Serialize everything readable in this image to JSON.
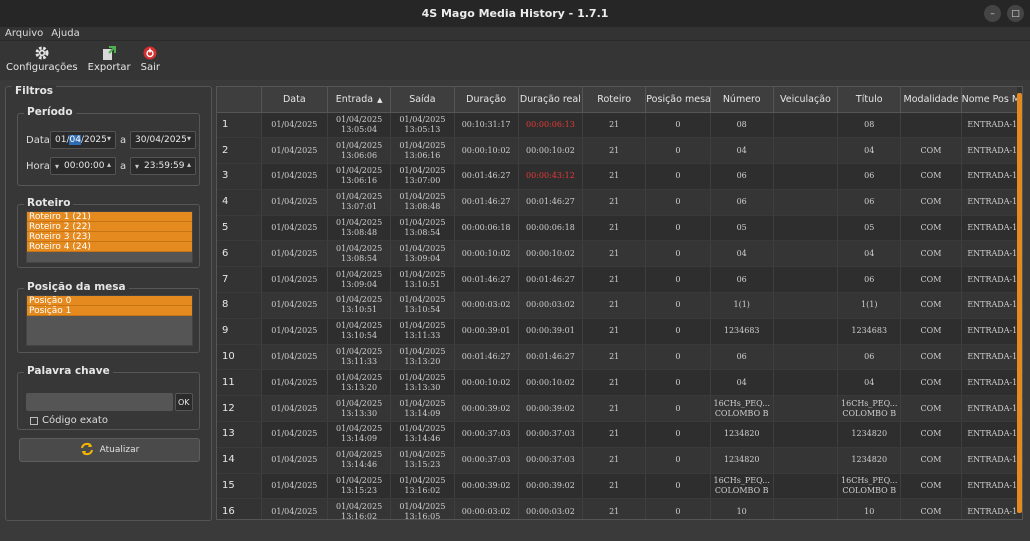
{
  "window": {
    "title": "4S Mago Media History - 1.7.1"
  },
  "menu": [
    "Arquivo",
    "Ajuda"
  ],
  "toolbar": {
    "config": "Configurações",
    "export": "Exportar",
    "exit": "Sair"
  },
  "filters": {
    "title": "Filtros",
    "period": {
      "title": "Período",
      "date_label": "Data",
      "date_from_pre": "01/",
      "date_from_sel": "04",
      "date_from_post": "/2025",
      "sep": "a",
      "date_to": "30/04/2025",
      "time_label": "Hora",
      "time_from": "00:00:00",
      "time_to": "23:59:59"
    },
    "roteiro": {
      "title": "Roteiro",
      "items": [
        "Roteiro 1 (21)",
        "Roteiro 2 (22)",
        "Roteiro 3 (23)",
        "Roteiro 4 (24)"
      ]
    },
    "posicao": {
      "title": "Posição da mesa",
      "items": [
        "Posição 0",
        "Posição 1"
      ]
    },
    "keyword": {
      "title": "Palavra chave",
      "value": "",
      "ok": "OK",
      "exact": "Código exato"
    },
    "refresh": "Atualizar"
  },
  "colors": {
    "accent": "#e58a1f",
    "red": "#e53935"
  },
  "table": {
    "headers": [
      "Data",
      "Entrada",
      "Saída",
      "Duração",
      "Duração real",
      "Roteiro",
      "Posição mesa",
      "Número",
      "Veiculação",
      "Título",
      "Modalidade",
      "Nome Pos Mes"
    ],
    "sort_indicator": "▲",
    "rows": [
      {
        "n": "1",
        "data": "01/04/2025",
        "entrada": [
          "01/04/2025",
          "13:05:04"
        ],
        "saida": [
          "01/04/2025",
          "13:05:13"
        ],
        "duracao": "00:10:31:17",
        "real": "00:00:06:13",
        "real_red": true,
        "roteiro": "21",
        "pos": "0",
        "numero": [
          "08"
        ],
        "veic": "",
        "titulo": [
          "08"
        ],
        "mod": "",
        "nome": "ENTRADA-1"
      },
      {
        "n": "2",
        "data": "01/04/2025",
        "entrada": [
          "01/04/2025",
          "13:06:06"
        ],
        "saida": [
          "01/04/2025",
          "13:06:16"
        ],
        "duracao": "00:00:10:02",
        "real": "00:00:10:02",
        "real_red": false,
        "roteiro": "21",
        "pos": "0",
        "numero": [
          "04"
        ],
        "veic": "",
        "titulo": [
          "04"
        ],
        "mod": "COM",
        "nome": "ENTRADA-1"
      },
      {
        "n": "3",
        "data": "01/04/2025",
        "entrada": [
          "01/04/2025",
          "13:06:16"
        ],
        "saida": [
          "01/04/2025",
          "13:07:00"
        ],
        "duracao": "00:01:46:27",
        "real": "00:00:43:12",
        "real_red": true,
        "roteiro": "21",
        "pos": "0",
        "numero": [
          "06"
        ],
        "veic": "",
        "titulo": [
          "06"
        ],
        "mod": "COM",
        "nome": "ENTRADA-1"
      },
      {
        "n": "4",
        "data": "01/04/2025",
        "entrada": [
          "01/04/2025",
          "13:07:01"
        ],
        "saida": [
          "01/04/2025",
          "13:08:48"
        ],
        "duracao": "00:01:46:27",
        "real": "00:01:46:27",
        "real_red": false,
        "roteiro": "21",
        "pos": "0",
        "numero": [
          "06"
        ],
        "veic": "",
        "titulo": [
          "06"
        ],
        "mod": "COM",
        "nome": "ENTRADA-1"
      },
      {
        "n": "5",
        "data": "01/04/2025",
        "entrada": [
          "01/04/2025",
          "13:08:48"
        ],
        "saida": [
          "01/04/2025",
          "13:08:54"
        ],
        "duracao": "00:00:06:18",
        "real": "00:00:06:18",
        "real_red": false,
        "roteiro": "21",
        "pos": "0",
        "numero": [
          "05"
        ],
        "veic": "",
        "titulo": [
          "05"
        ],
        "mod": "COM",
        "nome": "ENTRADA-1"
      },
      {
        "n": "6",
        "data": "01/04/2025",
        "entrada": [
          "01/04/2025",
          "13:08:54"
        ],
        "saida": [
          "01/04/2025",
          "13:09:04"
        ],
        "duracao": "00:00:10:02",
        "real": "00:00:10:02",
        "real_red": false,
        "roteiro": "21",
        "pos": "0",
        "numero": [
          "04"
        ],
        "veic": "",
        "titulo": [
          "04"
        ],
        "mod": "COM",
        "nome": "ENTRADA-1"
      },
      {
        "n": "7",
        "data": "01/04/2025",
        "entrada": [
          "01/04/2025",
          "13:09:04"
        ],
        "saida": [
          "01/04/2025",
          "13:10:51"
        ],
        "duracao": "00:01:46:27",
        "real": "00:01:46:27",
        "real_red": false,
        "roteiro": "21",
        "pos": "0",
        "numero": [
          "06"
        ],
        "veic": "",
        "titulo": [
          "06"
        ],
        "mod": "COM",
        "nome": "ENTRADA-1"
      },
      {
        "n": "8",
        "data": "01/04/2025",
        "entrada": [
          "01/04/2025",
          "13:10:51"
        ],
        "saida": [
          "01/04/2025",
          "13:10:54"
        ],
        "duracao": "00:00:03:02",
        "real": "00:00:03:02",
        "real_red": false,
        "roteiro": "21",
        "pos": "0",
        "numero": [
          "1(1)"
        ],
        "veic": "",
        "titulo": [
          "1(1)"
        ],
        "mod": "COM",
        "nome": "ENTRADA-1"
      },
      {
        "n": "9",
        "data": "01/04/2025",
        "entrada": [
          "01/04/2025",
          "13:10:54"
        ],
        "saida": [
          "01/04/2025",
          "13:11:33"
        ],
        "duracao": "00:00:39:01",
        "real": "00:00:39:01",
        "real_red": false,
        "roteiro": "21",
        "pos": "0",
        "numero": [
          "1234683"
        ],
        "veic": "",
        "titulo": [
          "1234683"
        ],
        "mod": "COM",
        "nome": "ENTRADA-1"
      },
      {
        "n": "10",
        "data": "01/04/2025",
        "entrada": [
          "01/04/2025",
          "13:11:33"
        ],
        "saida": [
          "01/04/2025",
          "13:13:20"
        ],
        "duracao": "00:01:46:27",
        "real": "00:01:46:27",
        "real_red": false,
        "roteiro": "21",
        "pos": "0",
        "numero": [
          "06"
        ],
        "veic": "",
        "titulo": [
          "06"
        ],
        "mod": "COM",
        "nome": "ENTRADA-1"
      },
      {
        "n": "11",
        "data": "01/04/2025",
        "entrada": [
          "01/04/2025",
          "13:13:20"
        ],
        "saida": [
          "01/04/2025",
          "13:13:30"
        ],
        "duracao": "00:00:10:02",
        "real": "00:00:10:02",
        "real_red": false,
        "roteiro": "21",
        "pos": "0",
        "numero": [
          "04"
        ],
        "veic": "",
        "titulo": [
          "04"
        ],
        "mod": "COM",
        "nome": "ENTRADA-1"
      },
      {
        "n": "12",
        "data": "01/04/2025",
        "entrada": [
          "01/04/2025",
          "13:13:30"
        ],
        "saida": [
          "01/04/2025",
          "13:14:09"
        ],
        "duracao": "00:00:39:02",
        "real": "00:00:39:02",
        "real_red": false,
        "roteiro": "21",
        "pos": "0",
        "numero": [
          "16CHs_PEQ...",
          "COLOMBO B"
        ],
        "veic": "",
        "titulo": [
          "16CHs_PEQ...",
          "COLOMBO B"
        ],
        "mod": "COM",
        "nome": "ENTRADA-1"
      },
      {
        "n": "13",
        "data": "01/04/2025",
        "entrada": [
          "01/04/2025",
          "13:14:09"
        ],
        "saida": [
          "01/04/2025",
          "13:14:46"
        ],
        "duracao": "00:00:37:03",
        "real": "00:00:37:03",
        "real_red": false,
        "roteiro": "21",
        "pos": "0",
        "numero": [
          "1234820"
        ],
        "veic": "",
        "titulo": [
          "1234820"
        ],
        "mod": "COM",
        "nome": "ENTRADA-1"
      },
      {
        "n": "14",
        "data": "01/04/2025",
        "entrada": [
          "01/04/2025",
          "13:14:46"
        ],
        "saida": [
          "01/04/2025",
          "13:15:23"
        ],
        "duracao": "00:00:37:03",
        "real": "00:00:37:03",
        "real_red": false,
        "roteiro": "21",
        "pos": "0",
        "numero": [
          "1234820"
        ],
        "veic": "",
        "titulo": [
          "1234820"
        ],
        "mod": "COM",
        "nome": "ENTRADA-1"
      },
      {
        "n": "15",
        "data": "01/04/2025",
        "entrada": [
          "01/04/2025",
          "13:15:23"
        ],
        "saida": [
          "01/04/2025",
          "13:16:02"
        ],
        "duracao": "00:00:39:02",
        "real": "00:00:39:02",
        "real_red": false,
        "roteiro": "21",
        "pos": "0",
        "numero": [
          "16CHs_PEQ...",
          "COLOMBO B"
        ],
        "veic": "",
        "titulo": [
          "16CHs_PEQ...",
          "COLOMBO B"
        ],
        "mod": "COM",
        "nome": "ENTRADA-1"
      },
      {
        "n": "16",
        "data": "01/04/2025",
        "entrada": [
          "01/04/2025",
          "13:16:02"
        ],
        "saida": [
          "01/04/2025",
          "13:16:05"
        ],
        "duracao": "00:00:03:02",
        "real": "00:00:03:02",
        "real_red": false,
        "roteiro": "21",
        "pos": "0",
        "numero": [
          "10"
        ],
        "veic": "",
        "titulo": [
          "10"
        ],
        "mod": "COM",
        "nome": "ENTRADA-1"
      }
    ]
  }
}
